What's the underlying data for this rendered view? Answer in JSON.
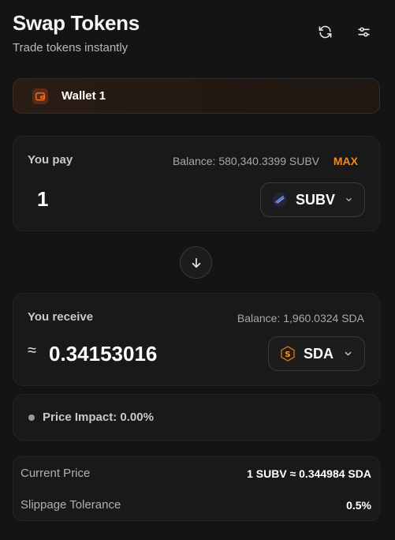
{
  "header": {
    "title": "Swap Tokens",
    "subtitle": "Trade tokens instantly",
    "refresh_icon": "refresh-icon",
    "settings_icon": "sliders-icon"
  },
  "wallet": {
    "label": "Wallet 1",
    "icon": "wallet-icon"
  },
  "pay": {
    "label": "You pay",
    "balance": "Balance: 580,340.3399 SUBV",
    "max_label": "MAX",
    "amount": "1",
    "token": "SUBV"
  },
  "swap_direction_icon": "arrow-down-icon",
  "receive": {
    "label": "You receive",
    "balance": "Balance: 1,960.0324 SDA",
    "approx_symbol": "≈",
    "amount": "0.34153016",
    "token": "SDA"
  },
  "price_impact": {
    "text": "Price Impact: 0.00%"
  },
  "details": {
    "current_price_label": "Current Price",
    "current_price_value": "1 SUBV ≈ 0.344984 SDA",
    "slippage_label": "Slippage Tolerance",
    "slippage_value": "0.5%"
  },
  "colors": {
    "background": "#141414",
    "card": "#191919",
    "accent": "#f08a1f",
    "wallet_bg": "#2a1d14"
  }
}
